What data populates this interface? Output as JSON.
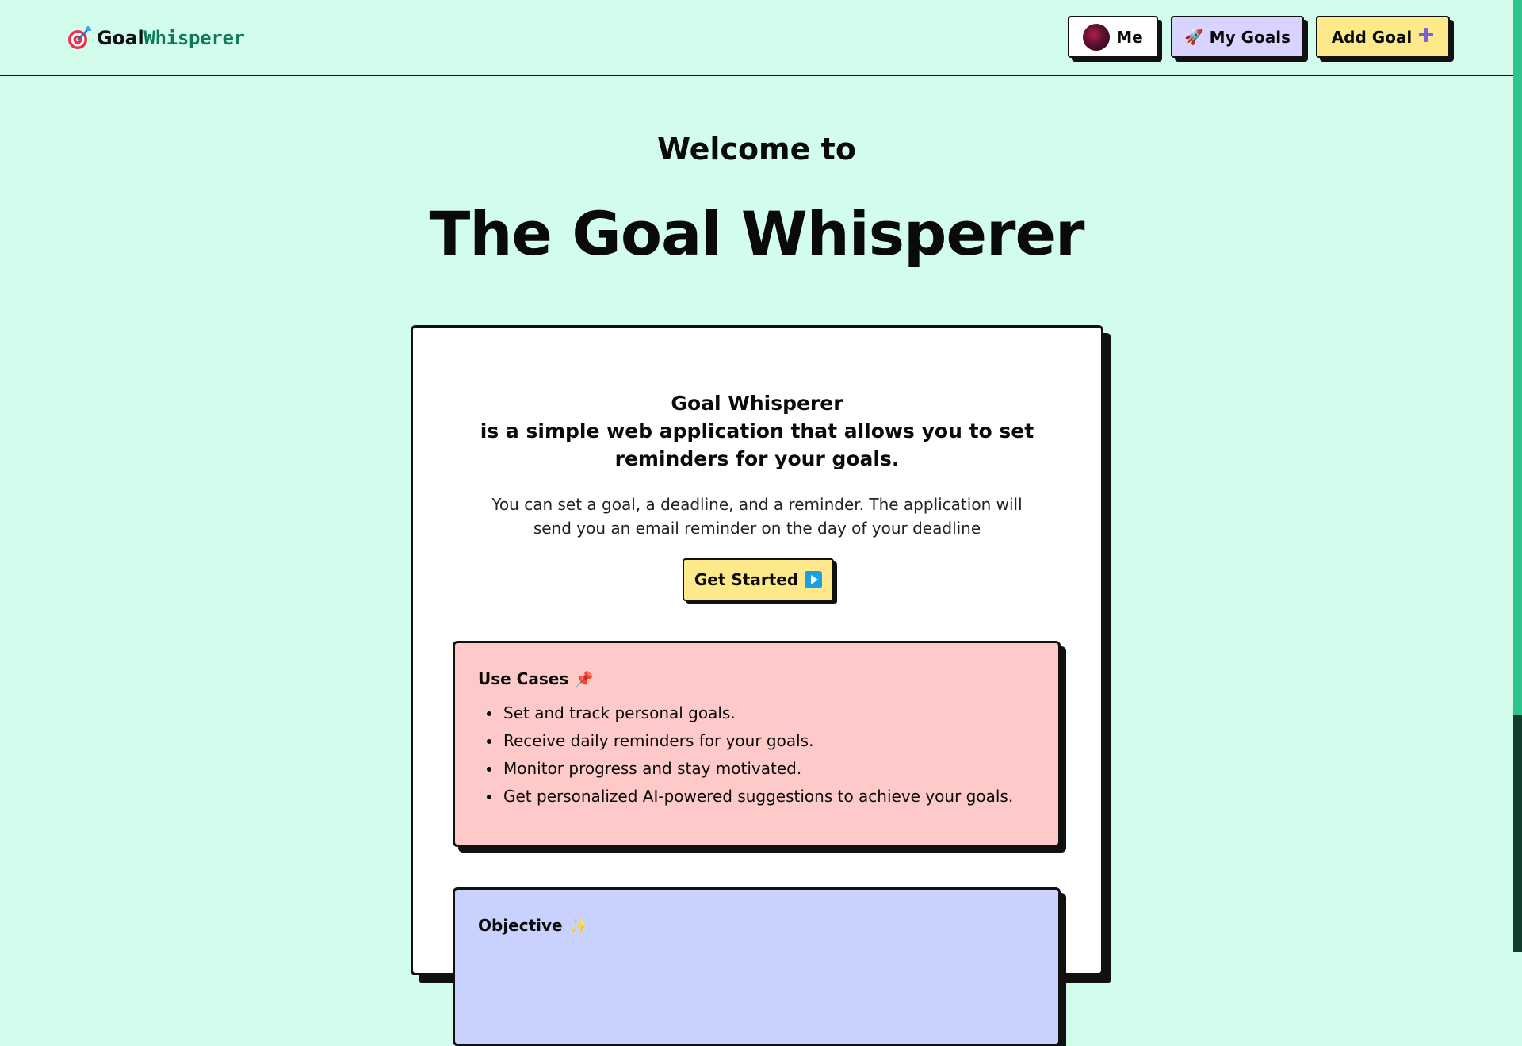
{
  "header": {
    "logo_bold": "Goal",
    "logo_mono": "Whisperer",
    "logo_icon": "target-dart-icon",
    "nav": {
      "me_label": "Me",
      "goals_label": "My Goals",
      "goals_icon": "🚀",
      "add_label": "Add Goal",
      "add_icon": "+"
    }
  },
  "hero": {
    "welcome": "Welcome to",
    "title": "The Goal Whisperer"
  },
  "card": {
    "head_line1": "Goal Whisperer",
    "head_line2": "is a simple web application that allows you to set",
    "head_line3": "reminders for your goals.",
    "desc": "You can set a goal, a deadline, and a reminder. The application will send you an email reminder on the day of your deadline",
    "cta_label": "Get Started",
    "use_cases": {
      "title": "Use Cases",
      "emoji": "📌",
      "items": [
        "Set and track personal goals.",
        "Receive daily reminders for your goals.",
        "Monitor progress and stay motivated.",
        "Get personalized AI-powered suggestions to achieve your goals."
      ]
    },
    "objective": {
      "title": "Objective",
      "emoji": "✨"
    }
  },
  "colors": {
    "background": "#d2fdec",
    "me_button": "#ffffff",
    "goals_button": "#d9d3ff",
    "add_button": "#fde98a",
    "use_cases_bg": "#fec9c9",
    "objective_bg": "#c9d1ff",
    "logo_accent": "#0f7a57"
  }
}
